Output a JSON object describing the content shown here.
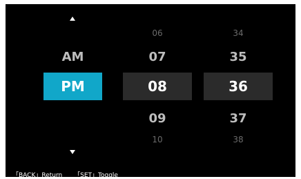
{
  "ampm": {
    "above": "AM",
    "selected": "PM"
  },
  "hours": {
    "far_above": "06",
    "above": "07",
    "selected": "08",
    "below": "09",
    "far_below": "10"
  },
  "minutes": {
    "far_above": "34",
    "above": "35",
    "selected": "36",
    "below": "37",
    "far_below": "38"
  },
  "footer": {
    "back_hint": "「BACK」Return",
    "set_hint": "「SET」Toggle"
  },
  "colors": {
    "accent": "#11a7c9",
    "selected_bg": "#2b2b2b",
    "screen_bg": "#000000"
  },
  "icons": {
    "up": "triangle-up-icon",
    "down": "triangle-down-icon"
  }
}
